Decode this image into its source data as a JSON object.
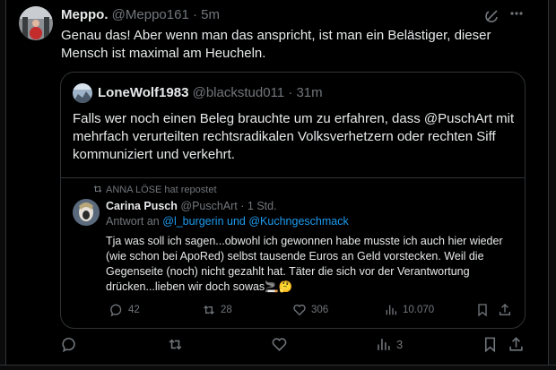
{
  "tweet": {
    "display_name": "Meppo.",
    "handle": "@Meppo161",
    "separator": "·",
    "time": "5m",
    "text": "Genau das! Aber wenn man das anspricht, ist man ein Belästiger, dieser Mensch ist maximal am Heucheln."
  },
  "quoted": {
    "display_name": "LoneWolf1983",
    "handle": "@blackstud011",
    "separator": "·",
    "time": "31m",
    "text": "Falls wer noch einen Beleg brauchte um zu erfahren, dass @PuschArt mit mehrfach verurteilten rechtsradikalen Volksverhetzern oder rechten Siff kommuniziert und verkehrt."
  },
  "inner": {
    "repost_label": "ANNA LÖSE hat repostet",
    "display_name": "Carina Pusch",
    "handle": "@PuschArt",
    "separator": "·",
    "time": "1 Std.",
    "reply_prefix": "Antwort an",
    "reply_user1": "@l_burgerin",
    "reply_and": "und",
    "reply_user2": "@Kuchngeschmack",
    "text": "Tja was soll ich sagen...obwohl ich gewonnen habe musste ich auch hier wieder (wie schon bei ApoRed) selbst tausende Euros an Geld vorstecken. Weil die Gegenseite (noch) nicht gezahlt hat. Täter die sich vor der Verantwortung drücken...lieben wir doch sowas🚬🤔",
    "replies": "42",
    "reposts": "28",
    "likes": "306",
    "views": "10.070"
  },
  "main_actions": {
    "views": "3"
  },
  "colors": {
    "background": "#000000",
    "text": "#e7e9ea",
    "muted": "#71767b",
    "link": "#1d9bf0",
    "border": "#2f3336"
  },
  "icons": [
    "grok-icon",
    "more-icon",
    "repost-icon",
    "reply-icon",
    "like-icon",
    "views-icon",
    "bookmark-icon",
    "share-icon"
  ]
}
